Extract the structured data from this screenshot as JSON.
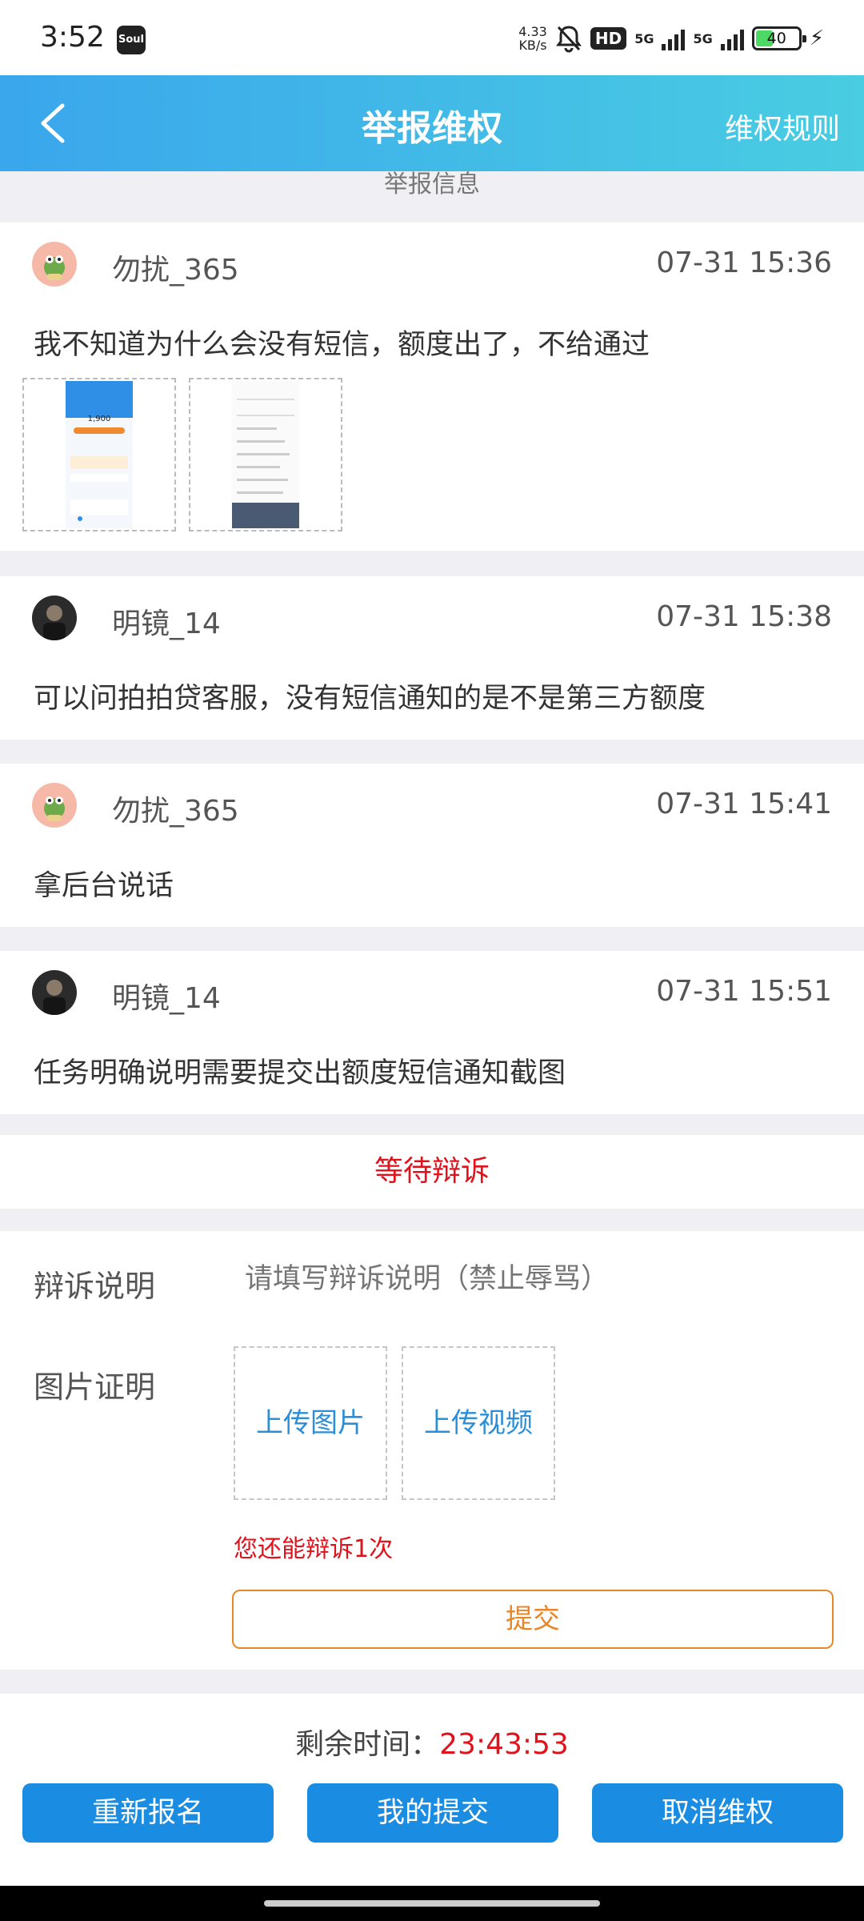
{
  "status_bar": {
    "time": "3:52",
    "app_badge": "Soul",
    "speed_value": "4.33",
    "speed_unit": "KB/s",
    "hd_label": "HD",
    "network_1": "5G",
    "network_2": "5G",
    "battery": "40"
  },
  "header": {
    "title": "举报维权",
    "rules_link": "维权规则",
    "back_icon": "chevron-left-icon"
  },
  "section_label": "举报信息",
  "messages": [
    {
      "user": "勿扰_365",
      "time": "07-31 15:36",
      "text": "我不知道为什么会没有短信，额度出了，不给通过",
      "avatar": "frog-avatar"
    },
    {
      "user": "明镜_14",
      "time": "07-31 15:38",
      "text": "可以问拍拍贷客服，没有短信通知的是不是第三方额度",
      "avatar": "dark-avatar"
    },
    {
      "user": "勿扰_365",
      "time": "07-31 15:41",
      "text": "拿后台说话",
      "avatar": "frog-avatar"
    },
    {
      "user": "明镜_14",
      "time": "07-31 15:51",
      "text": "任务明确说明需要提交出额度短信通知截图",
      "avatar": "dark-avatar"
    }
  ],
  "thumb_screen_1": {
    "amount": "1,900"
  },
  "status": "等待辩诉",
  "form": {
    "appeal_label": "辩诉说明",
    "appeal_placeholder": "请填写辩诉说明（禁止辱骂）",
    "proof_label": "图片证明",
    "upload_image": "上传图片",
    "upload_video": "上传视频",
    "remaining_text": "您还能辩诉1次",
    "submit": "提交"
  },
  "footer": {
    "timer_label": "剩余时间：",
    "timer_value": "23:43:53",
    "btn_reapply": "重新报名",
    "btn_my_submission": "我的提交",
    "btn_cancel": "取消维权"
  },
  "colors": {
    "header_start": "#3aa6ec",
    "header_end": "#49cde2",
    "accent_red": "#e0121b",
    "accent_orange": "#e8862a",
    "button_blue": "#1a8de2",
    "upload_blue": "#2a8fd8"
  }
}
